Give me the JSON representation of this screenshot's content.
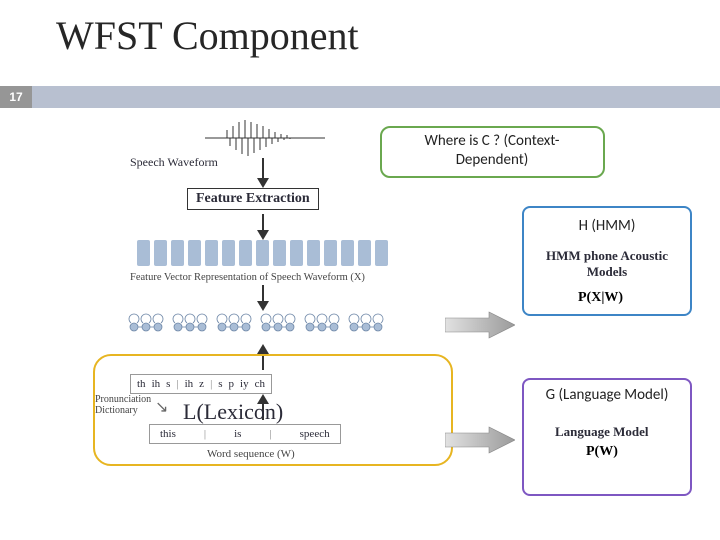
{
  "slide": {
    "title": "WFST Component",
    "number": "17"
  },
  "pipeline": {
    "waveform_label": "Speech Waveform",
    "feature_extraction_label": "Feature Extraction",
    "feature_rep_label": "Feature Vector Representation of Speech Waveform (X)",
    "pron_dict_label": "Pronunciation Dictionary",
    "word_seq_label": "Word sequence (W)",
    "phonemes": [
      "th",
      "ih",
      "s",
      "|",
      "ih",
      "z",
      "|",
      "s",
      "p",
      "iy",
      "ch"
    ],
    "words": [
      "this",
      "|",
      "is",
      "|",
      "speech"
    ]
  },
  "callouts": {
    "c_context": "Where is C ? (Context-Dependent)",
    "h_hmm": "H (HMM)",
    "l_lexicon": "L(Lexicon)",
    "g_lm": "G (Language Model)"
  },
  "model_labels": {
    "hmm_phone": "HMM phone Acoustic Models",
    "pxw": "P(X|W)",
    "lm": "Language Model",
    "pw": "P(W)"
  }
}
